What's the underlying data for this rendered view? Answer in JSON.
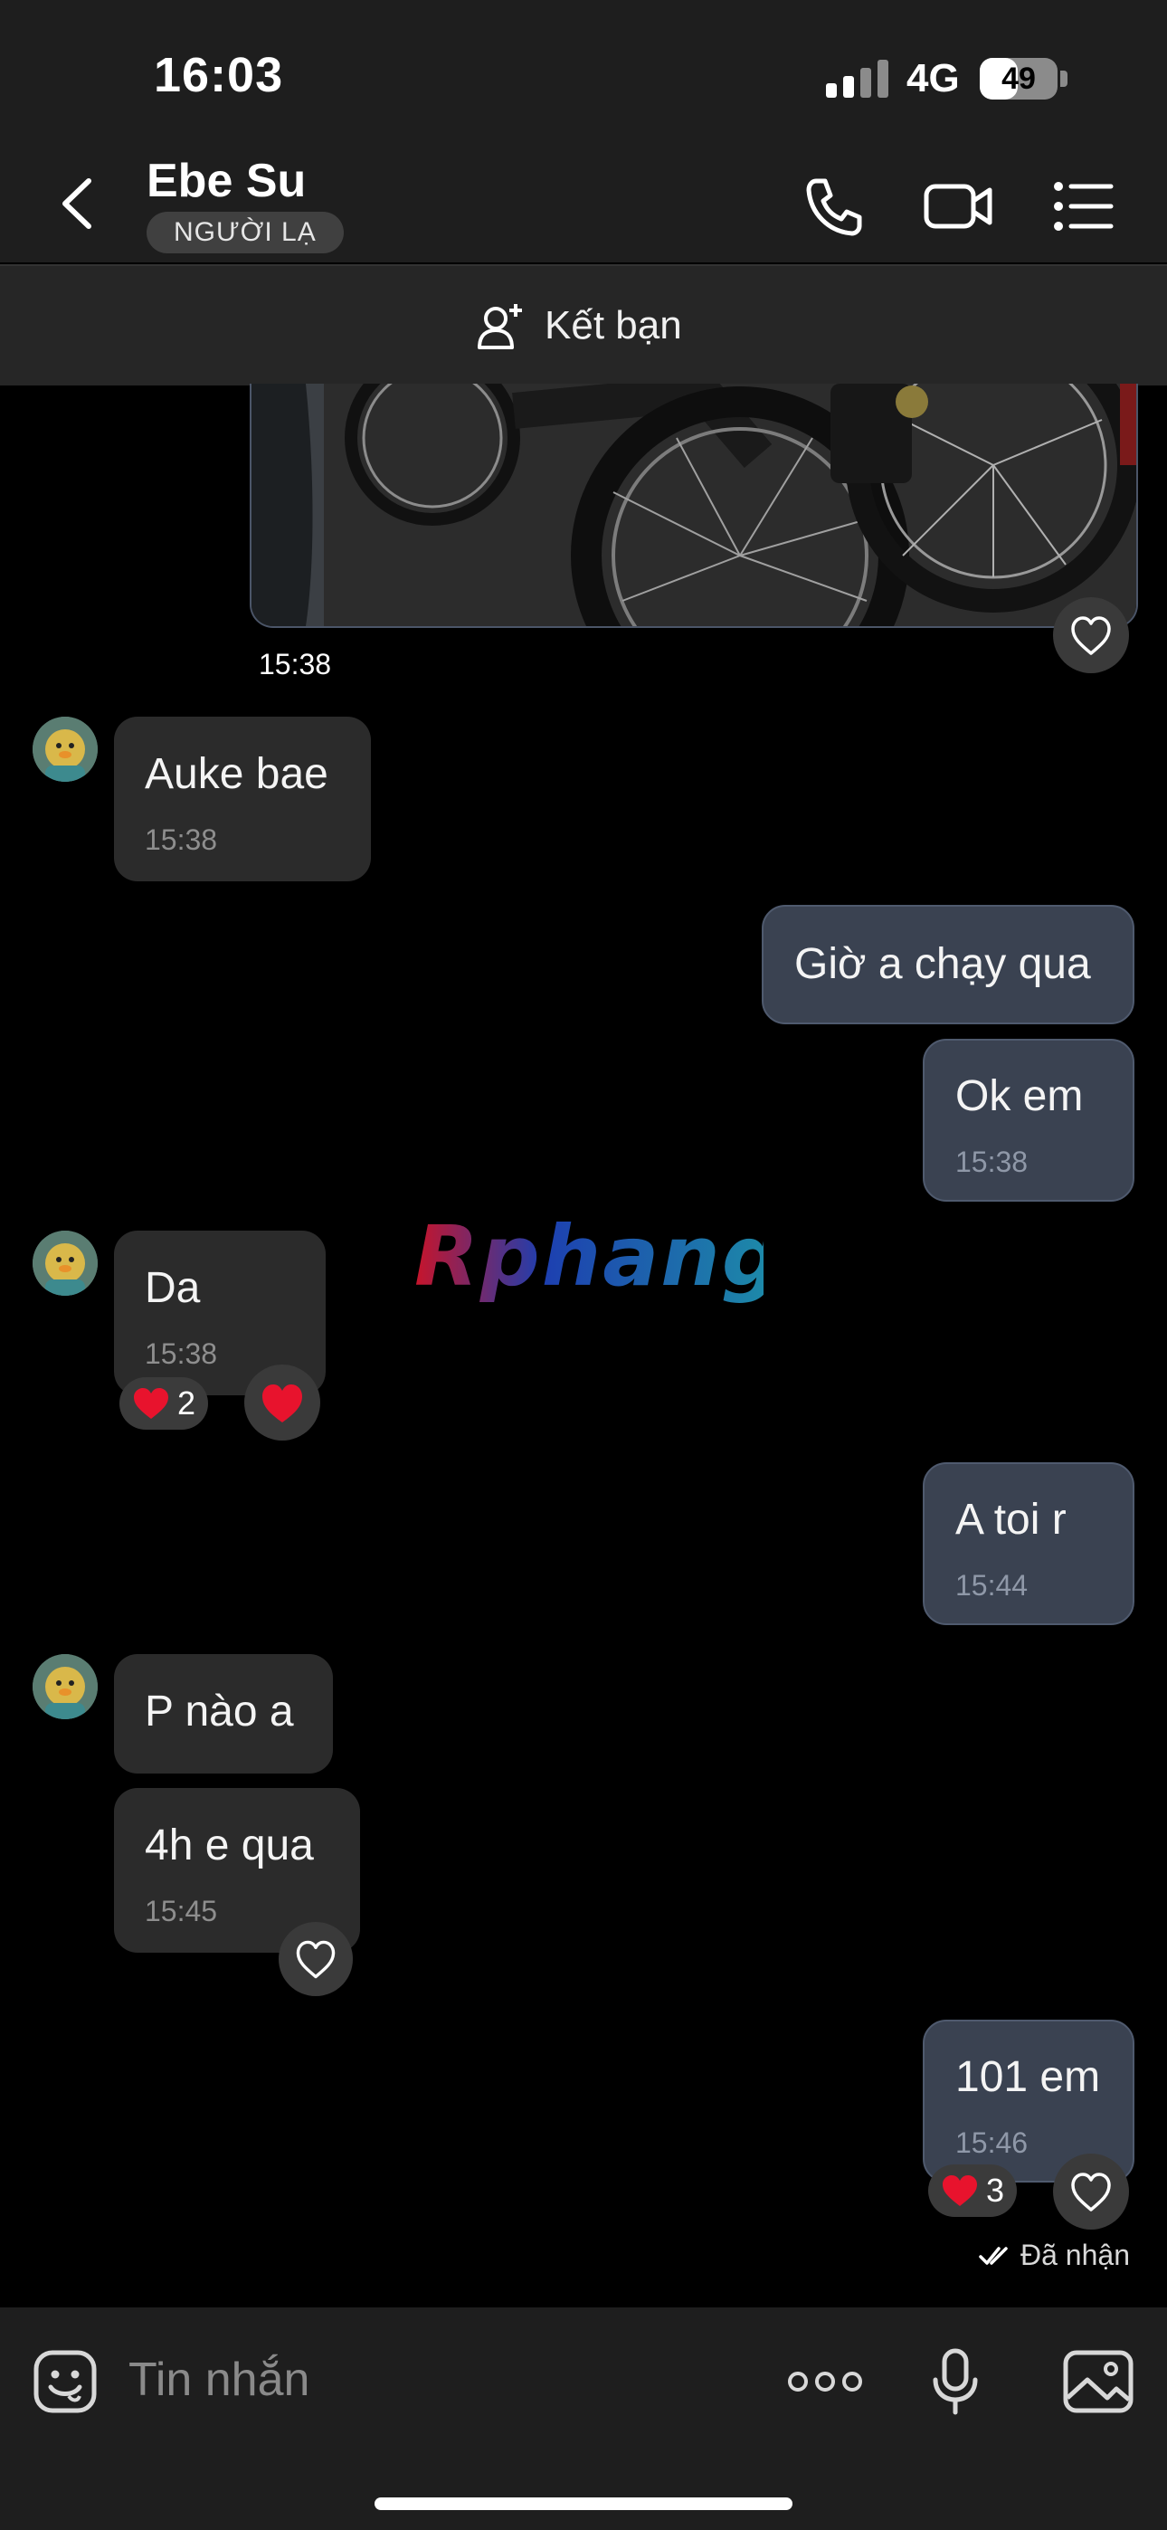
{
  "status_bar": {
    "time": "16:03",
    "network": "4G",
    "battery": "49",
    "battery_level": 0.49
  },
  "header": {
    "title": "Ebe Su",
    "badge": "NGƯỜI LẠ"
  },
  "add_friend": {
    "label": "Kết bạn"
  },
  "messages": [
    {
      "sender": "me",
      "type": "image",
      "time": "15:38"
    },
    {
      "sender": "them",
      "text": "Auke bae",
      "time": "15:38"
    },
    {
      "sender": "me",
      "text": "Giờ a chạy qua"
    },
    {
      "sender": "me",
      "text": "Ok em",
      "time": "15:38"
    },
    {
      "sender": "them",
      "text": "Da",
      "time": "15:38",
      "reaction_count": "2"
    },
    {
      "sender": "me",
      "text": "A toi r",
      "time": "15:44"
    },
    {
      "sender": "them",
      "text": "P nào a"
    },
    {
      "sender": "them",
      "text": "4h e qua",
      "time": "15:45"
    },
    {
      "sender": "me",
      "text": "101 em",
      "time": "15:46",
      "reaction_count": "3"
    }
  ],
  "receipt": "Đã nhận",
  "watermark": "Rphang",
  "input": {
    "placeholder": "Tin nhắn"
  },
  "colors": {
    "incoming": "#2b2b2b",
    "outgoing": "#3a4251",
    "heart": "#e8132d"
  }
}
